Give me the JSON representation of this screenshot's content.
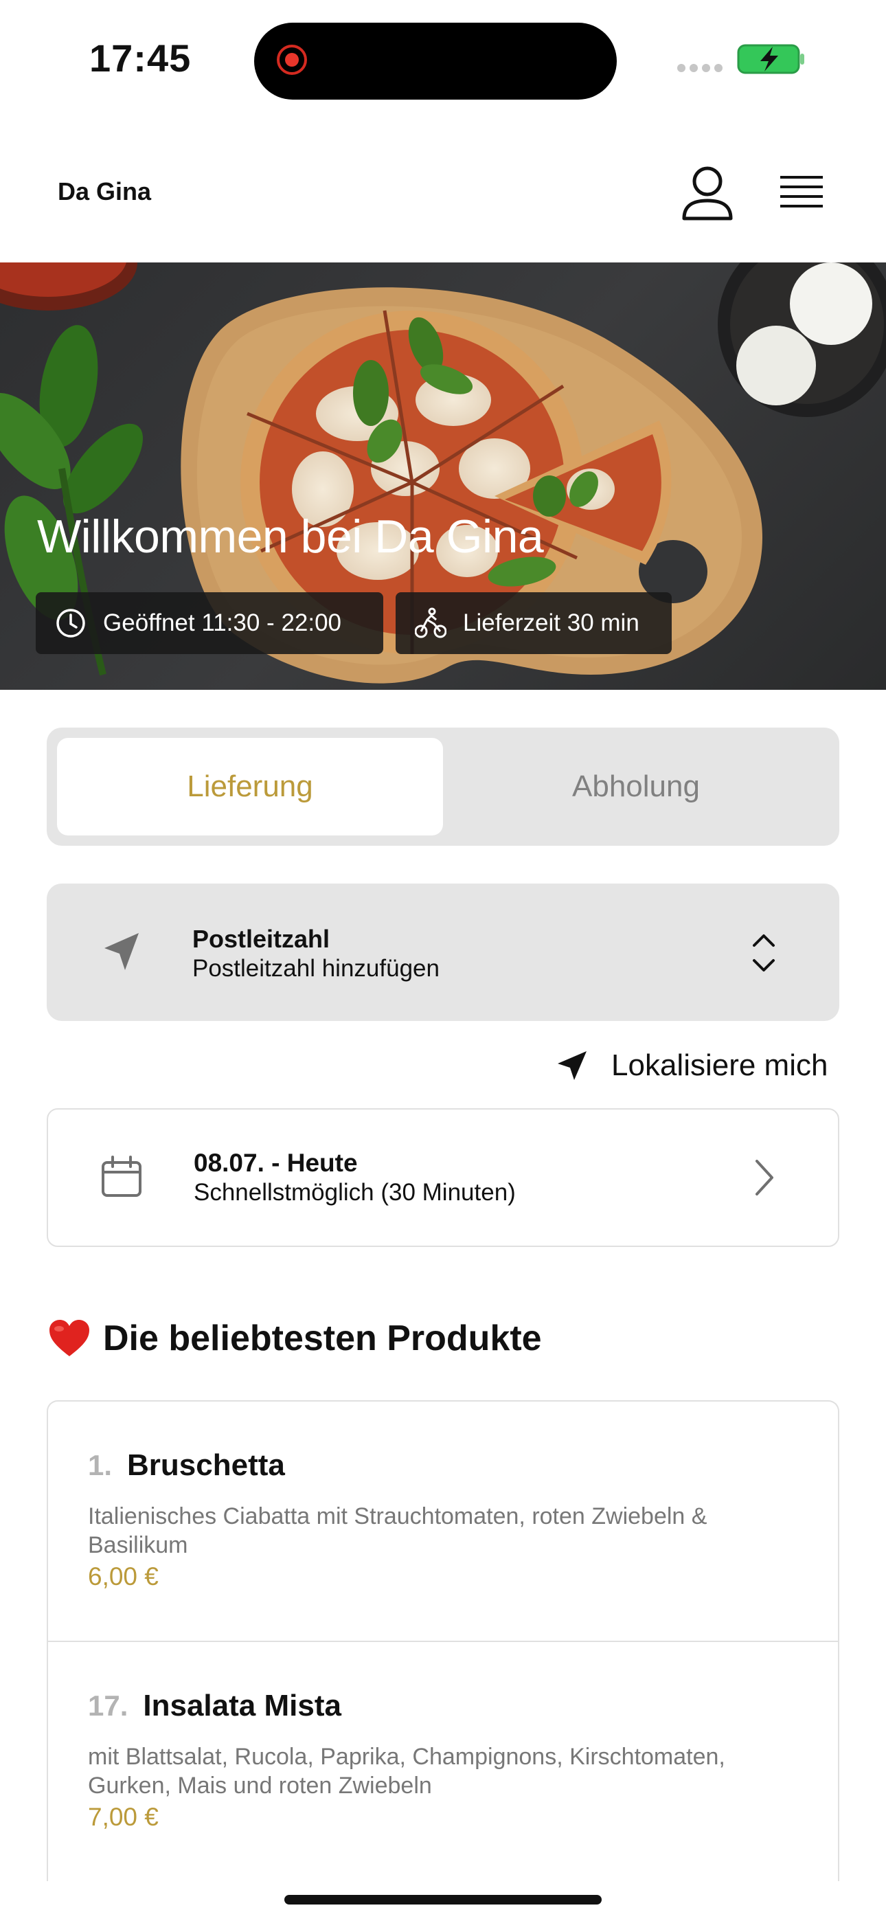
{
  "status_bar": {
    "time": "17:45"
  },
  "header": {
    "title": "Da Gina"
  },
  "hero": {
    "title": "Willkommen bei Da Gina",
    "opening_hours": "Geöffnet 11:30 - 22:00",
    "delivery_time": "Lieferzeit 30 min"
  },
  "order_mode": {
    "tabs": [
      {
        "label": "Lieferung",
        "selected": true
      },
      {
        "label": "Abholung",
        "selected": false
      }
    ],
    "active_color": "#bb9a3a",
    "inactive_color": "#808080"
  },
  "postal_code": {
    "label": "Postleitzahl",
    "placeholder": "Postleitzahl hinzufügen"
  },
  "locate_me": {
    "label": "Lokalisiere mich"
  },
  "schedule": {
    "date": "08.07. - Heute",
    "time": "Schnellstmöglich (30 Minuten)"
  },
  "popular": {
    "title": "Die beliebtesten Produkte",
    "products": [
      {
        "number": "1.",
        "name": "Bruschetta",
        "description": "Italienisches Ciabatta mit Strauchtomaten, roten Zwiebeln & Basilikum",
        "price": "6,00 €"
      },
      {
        "number": "17.",
        "name": "Insalata Mista",
        "description": "mit Blattsalat, Rucola, Paprika, Champignons, Kirschtomaten, Gurken, Mais und roten Zwiebeln",
        "price": "7,00 €"
      }
    ]
  },
  "icons": {
    "status": [
      "recording-dot-icon",
      "cellular-signal-icon",
      "battery-charging-icon"
    ],
    "header": [
      "profile-icon",
      "menu-icon"
    ],
    "hero": [
      "clock-icon",
      "bicycle-delivery-icon"
    ],
    "fields": [
      "location-arrow-icon",
      "chevron-up-down-icon",
      "calendar-icon",
      "chevron-right-icon",
      "heart-icon"
    ]
  },
  "colors": {
    "accent": "#bb9a3a",
    "battery_green": "#34c759",
    "heart": "#e0231f"
  }
}
